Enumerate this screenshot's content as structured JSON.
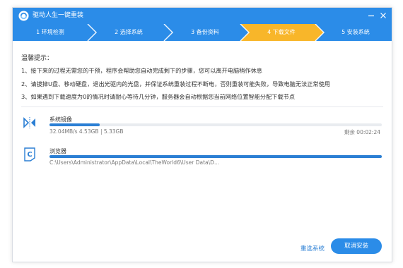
{
  "window": {
    "title": "驱动人生一键重装"
  },
  "steps": [
    {
      "label": "1 环境检测",
      "state": "done"
    },
    {
      "label": "2 选择系统",
      "state": "done"
    },
    {
      "label": "3 备份资料",
      "state": "done"
    },
    {
      "label": "4 下载文件",
      "state": "active"
    },
    {
      "label": "5 安装系统",
      "state": "todo"
    }
  ],
  "colors": {
    "primary": "#2b8ce8",
    "step_active": "#f8b62a",
    "progress": "#2b7fd4"
  },
  "tips": {
    "heading": "温馨提示：",
    "lines": [
      "1、接下来的过程无需您的干预，程序会帮助您自动完成剩下的步骤，您可以离开电脑稍作休息",
      "2、请拔掉U盘、移动硬盘，退出光驱内的光盘，并保证系统重装过程不断电，否则重装可能失败，导致电脑无法正常使用",
      "3、如果遇到下载速度为0的情况时请耐心等待几分钟，服务器会自动根据您当前网络位置智能分配下载节点"
    ]
  },
  "downloads": [
    {
      "name": "系统镜像",
      "icon": "system-image-icon",
      "detail": "32.04MB/s 4.53GB | 5.33GB",
      "remaining": "剩余 00:02:24",
      "progress": 0.15
    },
    {
      "name": "浏览器",
      "icon": "browser-icon",
      "detail": "C:\\Users\\Administrator\\AppData\\Local\\TheWorld6\\User Data\\D...",
      "progress": 1.0
    }
  ],
  "buttons": {
    "reselect": "重选系统",
    "cancel": "取消安装"
  }
}
